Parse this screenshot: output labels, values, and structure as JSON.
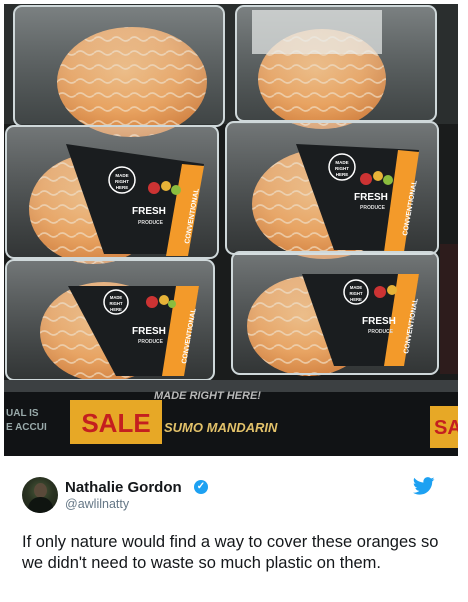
{
  "photo": {
    "labels": {
      "made_right_here": [
        "MADE",
        "RIGHT",
        "HERE"
      ],
      "fresh": "FRESH",
      "produce": "PRODUCE",
      "conventional": "CONVENTIONAL"
    },
    "shelf": {
      "sale": "SALE",
      "product": "SUMO MANDARIN",
      "handwritten": "MADE RIGHT HERE!",
      "left_partial_1": "UAL IS",
      "left_partial_2": "E ACCUI",
      "right_partial": "SA"
    }
  },
  "tweet": {
    "display_name": "Nathalie Gordon",
    "handle": "@awlilnatty",
    "text": "If only nature would find a way to cover these oranges so we didn't need to waste so much plastic on them.",
    "verified_icon": "verified-badge-icon",
    "brand_icon": "twitter-bird-icon",
    "colors": {
      "verified": "#1da1f2",
      "name": "#14171a",
      "handle": "#657786"
    }
  }
}
